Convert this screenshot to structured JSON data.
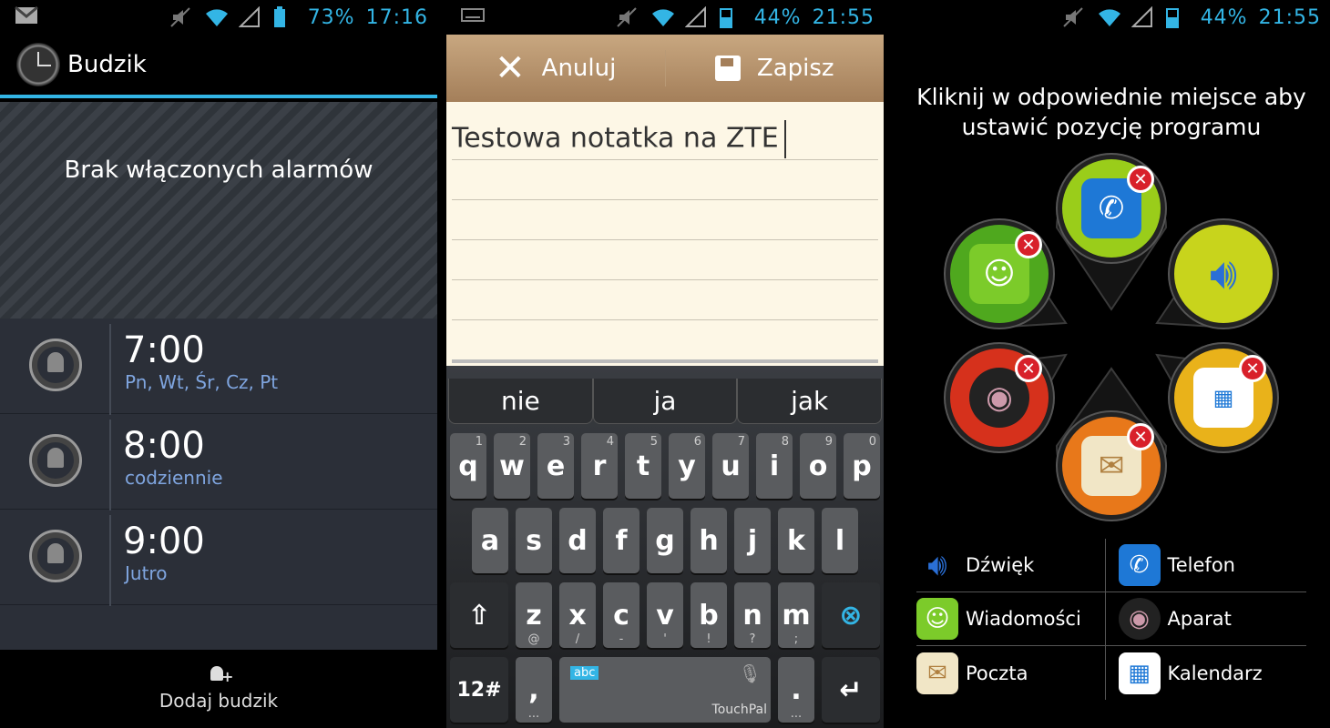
{
  "screen1": {
    "status": {
      "battery": "73%",
      "time": "17:16"
    },
    "title": "Budzik",
    "empty_message": "Brak włączonych alarmów",
    "alarms": [
      {
        "time": "7:00",
        "days": "Pn, Wt, Śr, Cz, Pt"
      },
      {
        "time": "8:00",
        "days": "codziennie"
      },
      {
        "time": "9:00",
        "days": "Jutro"
      }
    ],
    "add_label": "Dodaj budzik"
  },
  "screen2": {
    "status": {
      "battery": "44%",
      "time": "21:55"
    },
    "cancel_label": "Anuluj",
    "save_label": "Zapisz",
    "note_text": "Testowa notatka na ZTE",
    "suggestions": [
      "nie",
      "ja",
      "jak"
    ],
    "keys_row1": [
      [
        "q",
        "1"
      ],
      [
        "w",
        "2"
      ],
      [
        "e",
        "3"
      ],
      [
        "r",
        "4"
      ],
      [
        "t",
        "5"
      ],
      [
        "y",
        "6"
      ],
      [
        "u",
        "7"
      ],
      [
        "i",
        "8"
      ],
      [
        "o",
        "9"
      ],
      [
        "p",
        "0"
      ]
    ],
    "keys_row2": [
      "a",
      "s",
      "d",
      "f",
      "g",
      "h",
      "j",
      "k",
      "l"
    ],
    "keys_row3": [
      [
        "z",
        "@"
      ],
      [
        "x",
        "/"
      ],
      [
        "c",
        "-"
      ],
      [
        "v",
        "'"
      ],
      [
        "b",
        "!"
      ],
      [
        "n",
        "?"
      ],
      [
        "m",
        ";"
      ]
    ],
    "num_key": "12#",
    "comma_key": ",",
    "period_key": ".",
    "lang_label": "abc",
    "space_brand": "TouchPal"
  },
  "screen3": {
    "status": {
      "battery": "44%",
      "time": "21:55"
    },
    "prompt": "Kliknij w odpowiednie miejsce aby ustawić pozycję programu",
    "apps": [
      {
        "label": "Dźwięk",
        "icon": "speaker-icon"
      },
      {
        "label": "Telefon",
        "icon": "phone-icon"
      },
      {
        "label": "Wiadomości",
        "icon": "message-icon"
      },
      {
        "label": "Aparat",
        "icon": "camera-icon"
      },
      {
        "label": "Poczta",
        "icon": "mail-icon"
      },
      {
        "label": "Kalendarz",
        "icon": "calendar-icon"
      }
    ],
    "colors": {
      "accent": "#33b5e5",
      "green": "#5cb82a",
      "yellow": "#c8d41c",
      "red": "#d6311c",
      "orange": "#e8781a",
      "lime": "#9acd1a",
      "goldyellow": "#e9b21a"
    }
  }
}
